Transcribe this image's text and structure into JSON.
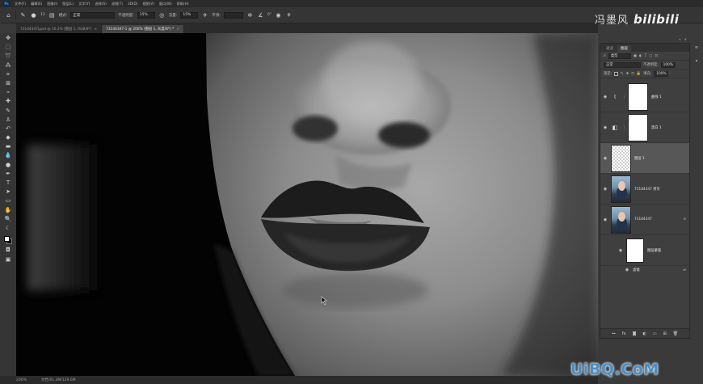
{
  "menubar": {
    "logo": "Ps",
    "items": [
      "文件(F)",
      "编辑(E)",
      "图像(I)",
      "图层(L)",
      "文字(Y)",
      "选择(S)",
      "滤镜(T)",
      "3D(D)",
      "视图(V)",
      "窗口(W)",
      "帮助(H)"
    ]
  },
  "options": {
    "brush_size": "13",
    "mode_label": "模式:",
    "mode_value": "正常",
    "opacity_label": "不透明度:",
    "opacity_value": "15%",
    "flow_label": "流量:",
    "flow_value": "15%",
    "smooth_label": "平滑:",
    "smooth_value": "",
    "angle_value": "0°"
  },
  "tabs": [
    {
      "label": "73144347Lpsd @ 16.2% (图层 1, RGB/8*)",
      "active": false
    },
    {
      "label": "73144347-1 @ 200% (图层 1, 灰度/8*) *",
      "active": true
    }
  ],
  "status": {
    "zoom": "200%",
    "doc": "文档:61.3M/129.6M"
  },
  "watermark": {
    "cn": "冯墨风",
    "bili": "bilibili"
  },
  "layers_panel": {
    "tabs": [
      "通道",
      "图层"
    ],
    "active_tab": "图层",
    "kind_label": "类型",
    "blend_mode": "正常",
    "opacity_label": "不透明度:",
    "opacity_value": "100%",
    "lock_label": "锁定:",
    "fill_label": "填充:",
    "fill_value": "100%",
    "layers": [
      {
        "name": "曲线 1",
        "type": "adjustment",
        "adj_icon": "curves-icon",
        "selected": false
      },
      {
        "name": "黑白 1",
        "type": "adjustment",
        "adj_icon": "black-white-icon",
        "selected": false
      },
      {
        "name": "图层 1",
        "type": "transparent",
        "selected": true
      },
      {
        "name": "73144347 拷贝",
        "type": "photo",
        "selected": false
      },
      {
        "name": "73144347",
        "type": "photo",
        "selected": false
      },
      {
        "name": "图层蒙版",
        "type": "mask",
        "selected": false
      }
    ],
    "sublabel": "滤镜"
  },
  "site_watermark": "UiBQ.CoM"
}
